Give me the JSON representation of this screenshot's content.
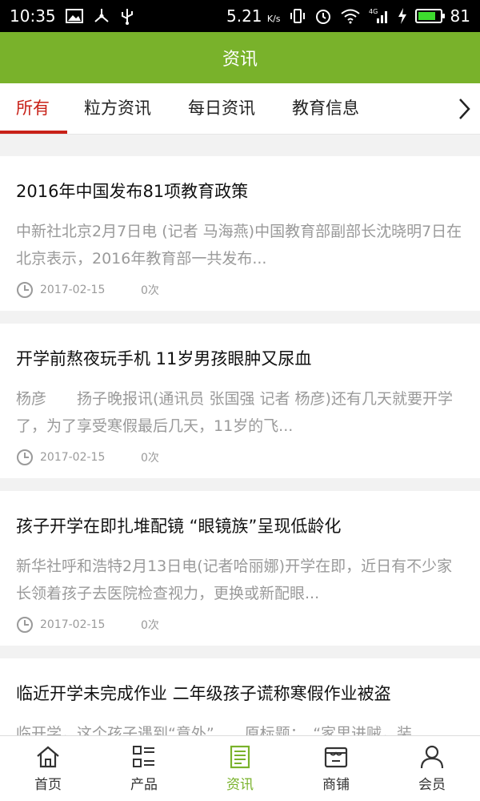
{
  "status_bar": {
    "time": "10:35",
    "speed": "5.21",
    "speed_unit": "K/s",
    "network": "4G",
    "battery": "81",
    "icons": [
      "image-icon",
      "share-network-icon",
      "usb-icon",
      "vibrate-icon",
      "alarm-icon",
      "wifi-icon",
      "signal-icon",
      "charging-icon",
      "battery-icon"
    ]
  },
  "header": {
    "title": "资讯"
  },
  "tabs": {
    "items": [
      {
        "label": "所有",
        "active": true
      },
      {
        "label": "粒方资讯"
      },
      {
        "label": "每日资讯"
      },
      {
        "label": "教育信息"
      }
    ],
    "more_icon": "chevron-right-icon",
    "accent": "#c82118"
  },
  "articles": [
    {
      "title": "2016年中国发布81项教育政策",
      "summary": "中新社北京2月7日电 (记者 马海燕)中国教育部副部长沈晓明7日在北京表示，2016年教育部一共发布...",
      "date": "2017-02-15",
      "views": "0次"
    },
    {
      "title": "开学前熬夜玩手机 11岁男孩眼肿又尿血",
      "summary": "杨彦　　扬子晚报讯(通讯员 张国强 记者 杨彦)还有几天就要开学了，为了享受寒假最后几天，11岁的飞...",
      "date": "2017-02-15",
      "views": "0次"
    },
    {
      "title": "孩子开学在即扎堆配镜 “眼镜族”呈现低龄化",
      "summary": "新华社呼和浩特2月13日电(记者哈丽娜)开学在即，近日有不少家长领着孩子去医院检查视力，更换或新配眼...",
      "date": "2017-02-15",
      "views": "0次"
    },
    {
      "title": "临近开学未完成作业 二年级孩子谎称寒假作业被盗",
      "summary": "临开学，这个孩子遇到“意外”　　原标题：　“家里进贼，装",
      "date": "",
      "views": ""
    }
  ],
  "bottom_nav": {
    "items": [
      {
        "label": "首页",
        "icon": "home-icon"
      },
      {
        "label": "产品",
        "icon": "product-list-icon"
      },
      {
        "label": "资讯",
        "icon": "news-icon",
        "active": true
      },
      {
        "label": "商铺",
        "icon": "shop-icon"
      },
      {
        "label": "会员",
        "icon": "member-icon"
      }
    ]
  },
  "colors": {
    "brand": "#79b22b",
    "accent": "#c82118",
    "muted_text": "#9a9a9a",
    "background": "#f2f2f2"
  }
}
